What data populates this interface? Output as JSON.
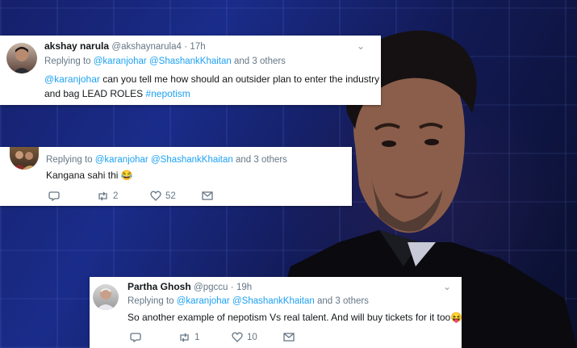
{
  "tweet1": {
    "name": "akshay narula",
    "handle": "@akshaynarula4",
    "sep": "·",
    "time": "17h",
    "replying_prefix": "Replying to",
    "mention1": "@karanjohar",
    "mention2": "@ShashankKhaitan",
    "and_others": "and 3 others",
    "body_mention": "@karanjohar",
    "body_line1": " can you tell me how should an outsider plan to enter the industry",
    "body_line2": "and bag LEAD ROLES ",
    "hashtag": "#nepotism"
  },
  "tweet2": {
    "replying_prefix": "Replying to",
    "mention1": "@karanjohar",
    "mention2": "@ShashankKhaitan",
    "and_others": "and 3 others",
    "body": "Kangana sahi thi 😂",
    "retweets": "2",
    "likes": "52"
  },
  "tweet3": {
    "name": "Partha Ghosh",
    "handle": "@pgccu",
    "sep": "·",
    "time": "19h",
    "replying_prefix": "Replying to",
    "mention1": "@karanjohar",
    "mention2": "@ShashankKhaitan",
    "and_others": "and 3 others",
    "body": "So another example of nepotism Vs real talent.  And will buy tickets for it too😝",
    "retweets": "1",
    "likes": "10"
  },
  "icons": {
    "reply": "reply-icon",
    "retweet": "retweet-icon",
    "like": "heart-icon",
    "message": "envelope-icon",
    "chevron": "chevron-down-icon"
  },
  "colors": {
    "link": "#1da1f2",
    "muted": "#657786",
    "text": "#14171a"
  }
}
